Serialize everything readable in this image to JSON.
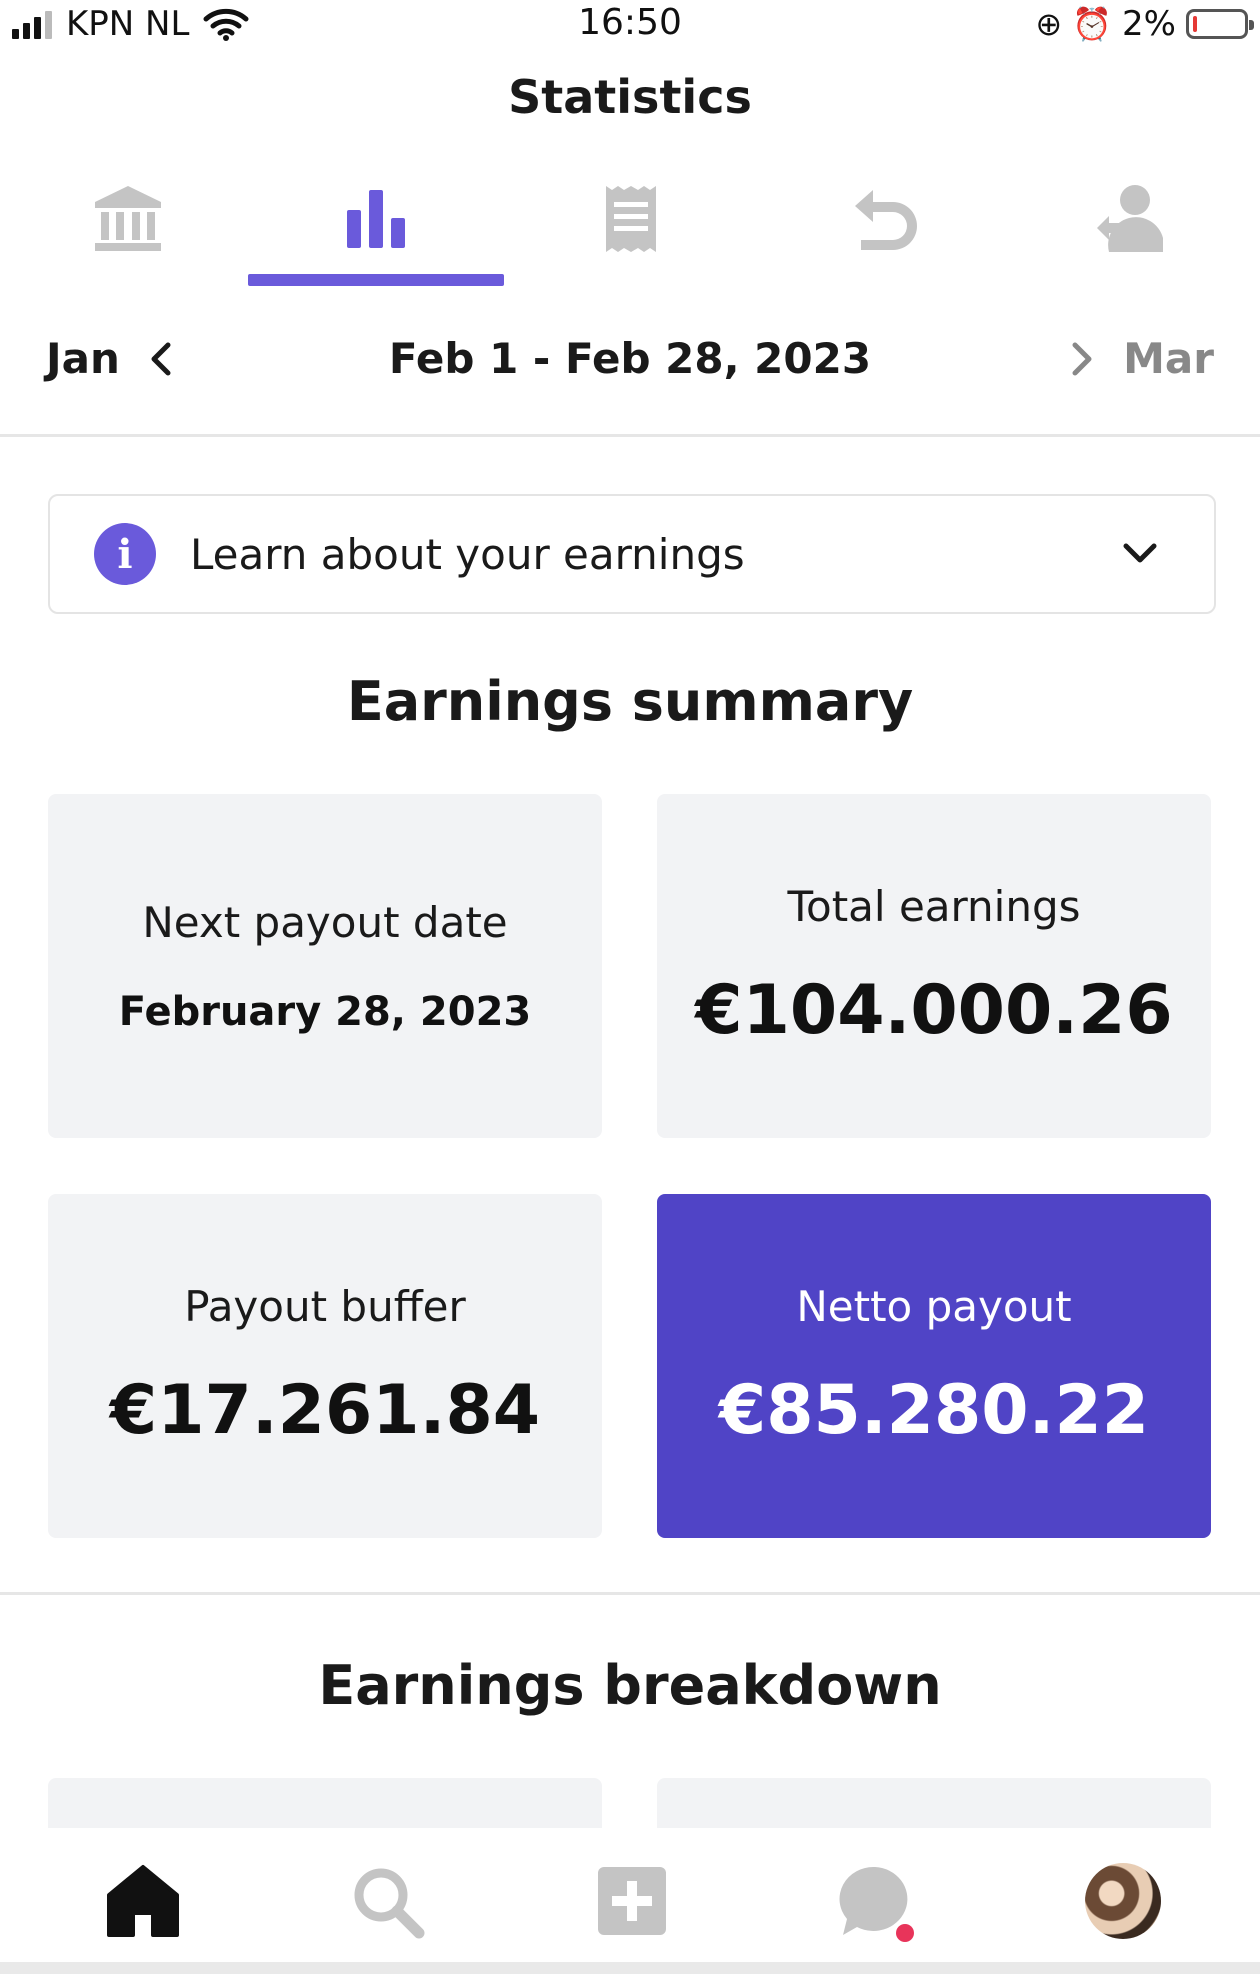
{
  "status_bar": {
    "carrier": "KPN NL",
    "time": "16:50",
    "battery_percent": "2%",
    "icons": [
      "signal-icon",
      "wifi-icon",
      "orientation-lock-icon",
      "alarm-icon",
      "battery-icon"
    ]
  },
  "header": {
    "title": "Statistics"
  },
  "tabs": {
    "items": [
      {
        "icon": "bank-icon",
        "active": false
      },
      {
        "icon": "bar-chart-icon",
        "active": true
      },
      {
        "icon": "receipt-icon",
        "active": false
      },
      {
        "icon": "undo-icon",
        "active": false
      },
      {
        "icon": "user-icon",
        "active": false
      }
    ]
  },
  "month_nav": {
    "prev_label": "Jan",
    "period": "Feb 1 - Feb 28, 2023",
    "next_label": "Mar"
  },
  "info": {
    "text": "Learn about your earnings"
  },
  "summary": {
    "title": "Earnings summary",
    "cards": [
      {
        "label": "Next payout date",
        "value": "February 28, 2023"
      },
      {
        "label": "Total earnings",
        "value": "€104.000.26"
      },
      {
        "label": "Payout buffer",
        "value": "€17.261.84"
      },
      {
        "label": "Netto payout",
        "value": "€85.280.22"
      }
    ]
  },
  "breakdown": {
    "title": "Earnings breakdown"
  },
  "bottom_nav": {
    "items": [
      "home-icon",
      "search-icon",
      "add-post-icon",
      "messages-icon",
      "profile-avatar"
    ]
  },
  "colors": {
    "accent": "#6a5adb",
    "card_accent": "#5044c6",
    "card_bg": "#f2f3f5",
    "icon_inactive": "#c4c4c4",
    "notification": "#e8345a"
  }
}
